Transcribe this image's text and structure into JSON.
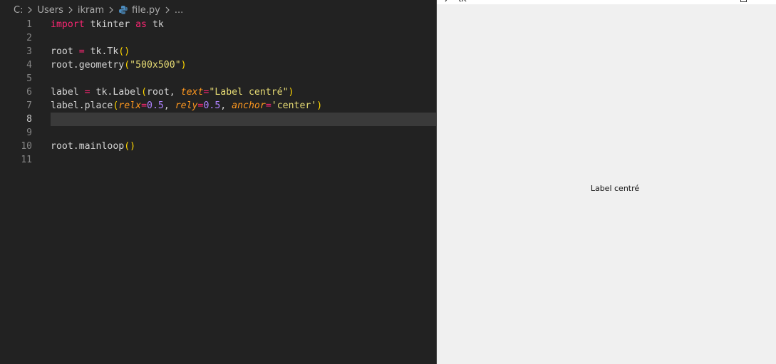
{
  "breadcrumb": {
    "items": [
      "C:",
      "Users",
      "ikram",
      "file.py",
      "..."
    ]
  },
  "editor": {
    "line_numbers": [
      "1",
      "2",
      "3",
      "4",
      "5",
      "6",
      "7",
      "8",
      "9",
      "10",
      "11"
    ],
    "active_line": "8",
    "lines": [
      [
        {
          "t": "import",
          "c": "kw"
        },
        {
          "t": " tkinter ",
          "c": ""
        },
        {
          "t": "as",
          "c": "kw"
        },
        {
          "t": " tk",
          "c": ""
        }
      ],
      [],
      [
        {
          "t": "root ",
          "c": ""
        },
        {
          "t": "=",
          "c": "op"
        },
        {
          "t": " tk.Tk",
          "c": ""
        },
        {
          "t": "()",
          "c": "br-y"
        }
      ],
      [
        {
          "t": "root.geometry",
          "c": ""
        },
        {
          "t": "(",
          "c": "br-y"
        },
        {
          "t": "\"500x500\"",
          "c": "st"
        },
        {
          "t": ")",
          "c": "br-y"
        }
      ],
      [],
      [
        {
          "t": "label ",
          "c": ""
        },
        {
          "t": "=",
          "c": "op"
        },
        {
          "t": " tk.Label",
          "c": ""
        },
        {
          "t": "(",
          "c": "br-y"
        },
        {
          "t": "root, ",
          "c": ""
        },
        {
          "t": "text",
          "c": "pr"
        },
        {
          "t": "=",
          "c": "op"
        },
        {
          "t": "\"Label centré\"",
          "c": "st"
        },
        {
          "t": ")",
          "c": "br-y"
        }
      ],
      [
        {
          "t": "label.place",
          "c": ""
        },
        {
          "t": "(",
          "c": "br-y"
        },
        {
          "t": "relx",
          "c": "pr"
        },
        {
          "t": "=",
          "c": "op"
        },
        {
          "t": "0.5",
          "c": "nm"
        },
        {
          "t": ", ",
          "c": ""
        },
        {
          "t": "rely",
          "c": "pr"
        },
        {
          "t": "=",
          "c": "op"
        },
        {
          "t": "0.5",
          "c": "nm"
        },
        {
          "t": ", ",
          "c": ""
        },
        {
          "t": "anchor",
          "c": "pr"
        },
        {
          "t": "=",
          "c": "op"
        },
        {
          "t": "'center'",
          "c": "st"
        },
        {
          "t": ")",
          "c": "br-y"
        }
      ],
      [],
      [],
      [
        {
          "t": "root.mainloop",
          "c": ""
        },
        {
          "t": "()",
          "c": "br-y"
        }
      ],
      []
    ]
  },
  "tk_window": {
    "title": "tk",
    "label": "Label centré"
  },
  "colors": {
    "editor_bg": "#222222",
    "keyword": "#f92672",
    "string": "#e6db74",
    "number": "#ae81ff",
    "param": "#fd971f",
    "tk_bg": "#f0f0f0"
  }
}
